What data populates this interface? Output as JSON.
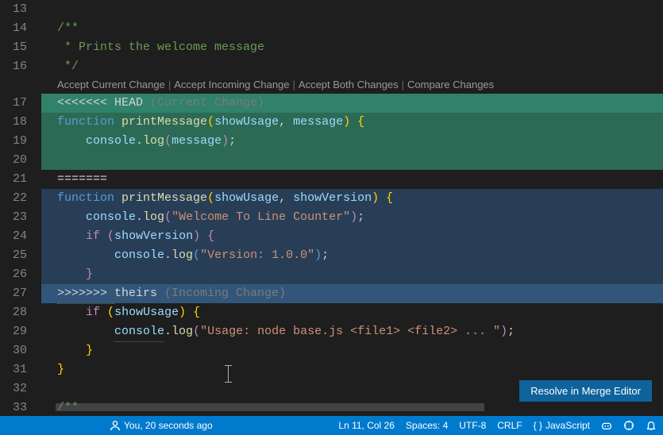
{
  "gutter": {
    "start": 13,
    "end": 33
  },
  "codelens": {
    "accept_current": "Accept Current Change",
    "accept_incoming": "Accept Incoming Change",
    "accept_both": "Accept Both Changes",
    "compare": "Compare Changes"
  },
  "code": {
    "l13": "",
    "l14_a": "/**",
    "l15_a": " *",
    "l15_b": " Prints the welcome message",
    "l16_a": " */",
    "l17_mark": "<<<<<<< ",
    "l17_head": "HEAD",
    "l17_label": " (Current Change)",
    "function_kw": "function",
    "func_name": "printMessage",
    "l18_p1": "showUsage",
    "l18_sep": ", ",
    "l18_p2": "message",
    "console": "console",
    "log": "log",
    "l19_arg": "message",
    "l21_sep": "=======",
    "l22_p1": "showUsage",
    "l22_p2": "showVersion",
    "l23_str": "\"Welcome To Line Counter\"",
    "if_kw": "if",
    "l24_cond": "showVersion",
    "l25_str": "\"Version: 1.0.0\"",
    "l27_mark": ">>>>>>> ",
    "l27_theirs": "theirs",
    "l27_label": " (Incoming Change)",
    "l28_cond": "showUsage",
    "l29_str": "\"Usage: node base.js <file1> <file2> ... \"",
    "l32_a": "/**"
  },
  "resolve_btn": "Resolve in Merge Editor",
  "status": {
    "blame": "You, 20 seconds ago",
    "position": "Ln 11, Col 26",
    "spaces": "Spaces: 4",
    "encoding": "UTF-8",
    "eol": "CRLF",
    "language": "JavaScript"
  }
}
